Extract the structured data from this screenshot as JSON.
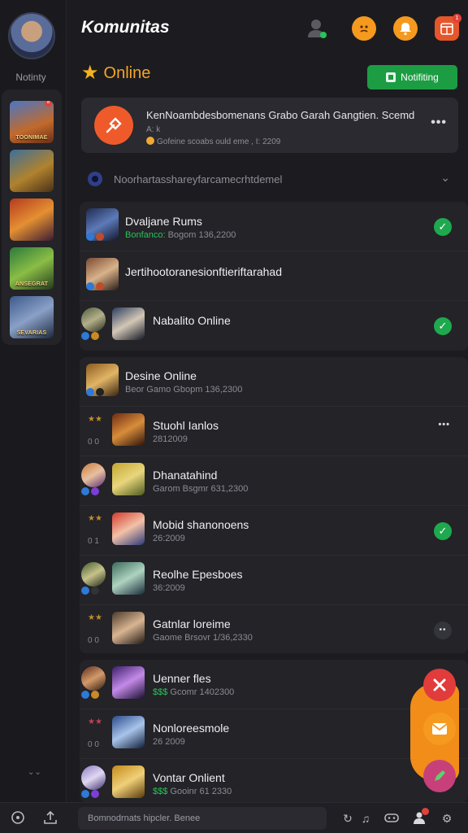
{
  "header": {
    "title": "Komunitas",
    "online_label": "Online",
    "notify_label": "Notifiting",
    "notif_count": "1"
  },
  "sidebar": {
    "username": "Notinty",
    "games": [
      {
        "label": "TOONIMAE",
        "badge": "8"
      },
      {
        "label": ""
      },
      {
        "label": ""
      },
      {
        "label": "ANSEGRAT"
      },
      {
        "label": "SEVARIAS"
      }
    ],
    "footer_mark": "⌄⌄"
  },
  "featured": {
    "title": "KenNoambdesbomenans Grabo Garah Gangtien. Scemd",
    "meta": "A: k",
    "status": "Gofeine scoabs  ould eme ,  I: 2209"
  },
  "section": {
    "text": "Noorhartasshareyfarcamecrhtdemel"
  },
  "group1": [
    {
      "name": "Dvaljane Rums",
      "status_green": "Bonfanco: ",
      "status": "Bogom 136,2200",
      "state": "check"
    },
    {
      "name": "Jertihootoranesionftieriftarahad",
      "status_green": "",
      "status": "",
      "state": "none"
    },
    {
      "name": "Nabalito Online",
      "status_green": "",
      "status": "",
      "state": "check"
    }
  ],
  "group2": [
    {
      "name": "Desine Online",
      "status_green": "",
      "status": "Beor Gamo  Gbopm 136,2300",
      "state": "none",
      "mark": ""
    },
    {
      "name": "Stuohl Ianlos",
      "status_green": "",
      "status": "2812009",
      "state": "more",
      "mark": "0 0"
    },
    {
      "name": "Dhanatahind",
      "status_green": "",
      "status": "Garom Bsgmr 631,2300",
      "state": "none",
      "mark": ""
    },
    {
      "name": "Mobid shanonoens",
      "status_green": "",
      "status": "26:2009",
      "state": "check",
      "mark": "0 1"
    },
    {
      "name": "Reolhe Epesboes",
      "status_green": "",
      "status": "36:2009",
      "state": "none",
      "mark": ""
    },
    {
      "name": "Gatnlar loreime",
      "status_green": "",
      "status": "Gaome Brsovr 1/36,2330",
      "state": "dots",
      "mark": "0 0"
    }
  ],
  "group3": [
    {
      "name": "Uenner fles",
      "status_green": "$$$",
      "status": "Gcomr 1402300",
      "state": "none",
      "mark": ""
    },
    {
      "name": "Nonloreesmole",
      "status_green": "",
      "status": "26 2009",
      "state": "none",
      "mark": "0 0"
    },
    {
      "name": "Vontar Onlient",
      "status_green": "$$$",
      "status": "Gooinr 61 2330",
      "state": "none",
      "mark": ""
    }
  ],
  "search": {
    "placeholder": "Bomnodrnats hipcler. Benee"
  },
  "colors": {
    "accent_green": "#1c9d43",
    "accent_orange": "#f18d18",
    "background": "#1c1c20"
  }
}
